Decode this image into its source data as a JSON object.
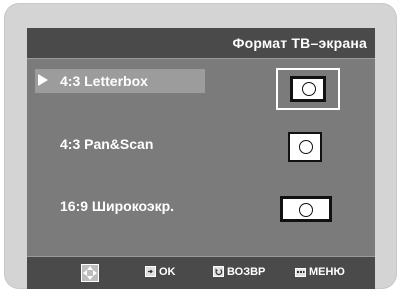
{
  "header": {
    "title": "Формат ТВ–экрана"
  },
  "options": [
    {
      "label": "4:3 Letterbox",
      "selected": true,
      "icon": "tv-letterbox-icon"
    },
    {
      "label": "4:3 Pan&Scan",
      "selected": false,
      "icon": "tv-panscan-icon"
    },
    {
      "label": "16:9 Широкоэкр.",
      "selected": false,
      "icon": "tv-widescreen-icon"
    }
  ],
  "footer": {
    "ok_label": "OK",
    "return_label": "ВОЗВР",
    "menu_label": "МЕНЮ",
    "icons": [
      "dpad-icon",
      "ok-icon",
      "return-icon",
      "menu-icon"
    ]
  },
  "colors": {
    "screen_bg": "#7b7b7b",
    "bar_bg": "#4a4a4a",
    "selection_bg": "#9c9c9c",
    "text": "#ffffff"
  }
}
